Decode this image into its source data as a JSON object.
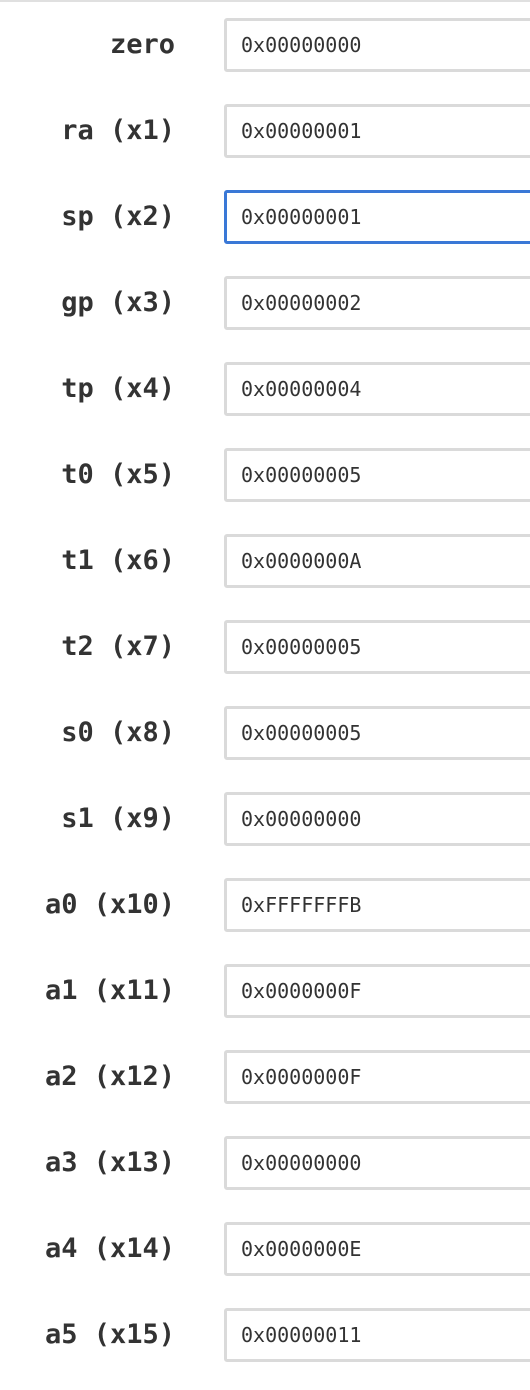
{
  "registers": [
    {
      "label": "zero",
      "value": "0x00000000",
      "focused": false
    },
    {
      "label": "ra (x1)",
      "value": "0x00000001",
      "focused": false
    },
    {
      "label": "sp (x2)",
      "value": "0x00000001",
      "focused": true
    },
    {
      "label": "gp (x3)",
      "value": "0x00000002",
      "focused": false
    },
    {
      "label": "tp (x4)",
      "value": "0x00000004",
      "focused": false
    },
    {
      "label": "t0 (x5)",
      "value": "0x00000005",
      "focused": false
    },
    {
      "label": "t1 (x6)",
      "value": "0x0000000A",
      "focused": false
    },
    {
      "label": "t2 (x7)",
      "value": "0x00000005",
      "focused": false
    },
    {
      "label": "s0 (x8)",
      "value": "0x00000005",
      "focused": false
    },
    {
      "label": "s1 (x9)",
      "value": "0x00000000",
      "focused": false
    },
    {
      "label": "a0 (x10)",
      "value": "0xFFFFFFFB",
      "focused": false
    },
    {
      "label": "a1 (x11)",
      "value": "0x0000000F",
      "focused": false
    },
    {
      "label": "a2 (x12)",
      "value": "0x0000000F",
      "focused": false
    },
    {
      "label": "a3 (x13)",
      "value": "0x00000000",
      "focused": false
    },
    {
      "label": "a4 (x14)",
      "value": "0x0000000E",
      "focused": false
    },
    {
      "label": "a5 (x15)",
      "value": "0x00000011",
      "focused": false
    }
  ],
  "colors": {
    "label_text": "#333333",
    "input_border": "#dadada",
    "input_focus_border": "#3a78d6"
  }
}
